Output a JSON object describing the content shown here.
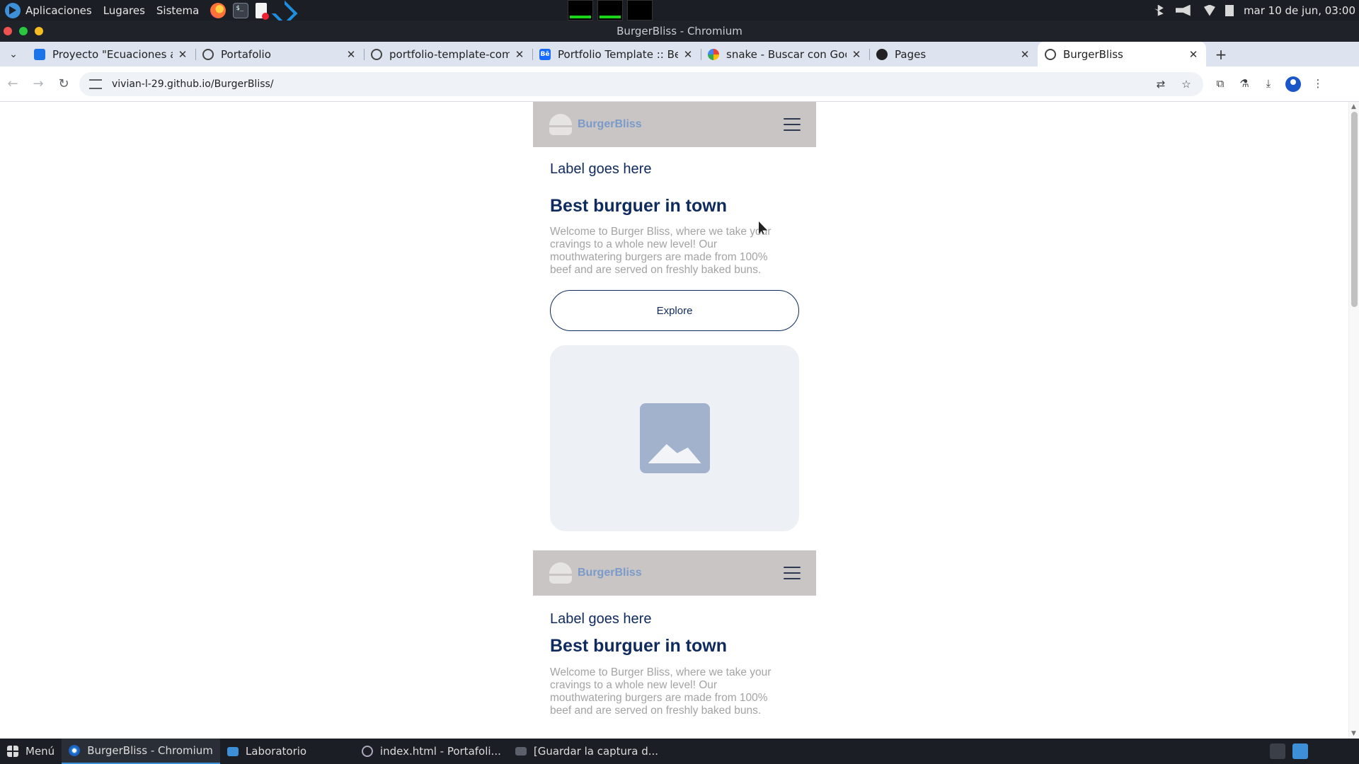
{
  "system_bar": {
    "menus": [
      "Aplicaciones",
      "Lugares",
      "Sistema"
    ],
    "clock": "mar 10 de jun, 03:00"
  },
  "window": {
    "title": "BurgerBliss - Chromium"
  },
  "tabs": [
    {
      "label": "Proyecto \"Ecuaciones aplicadas\"",
      "icon": "classroom-icon"
    },
    {
      "label": "Portafolio",
      "icon": "globe-icon"
    },
    {
      "label": "portfolio-template-community",
      "icon": "globe-icon"
    },
    {
      "label": "Portfolio Template :: Behance",
      "icon": "behance-icon"
    },
    {
      "label": "snake - Buscar con Google",
      "icon": "google-icon"
    },
    {
      "label": "Pages",
      "icon": "github-icon"
    },
    {
      "label": "BurgerBliss",
      "icon": "globe-icon"
    }
  ],
  "toolbar": {
    "url": "vivian-l-29.github.io/BurgerBliss/"
  },
  "page": {
    "brand": "BurgerBliss",
    "sections": [
      {
        "label": "Label goes here",
        "headline": "Best burguer in town",
        "body": "Welcome to Burger Bliss, where we take your cravings to a whole new level! Our mouthwatering burgers are made from 100% beef and are served on freshly baked buns.",
        "button": "Explore"
      },
      {
        "label": "Label goes here",
        "headline": "Best burguer in town",
        "body": "Welcome to Burger Bliss, where we take your cravings to a whole new level! Our mouthwatering burgers are made from 100% beef and are served on freshly baked buns."
      }
    ]
  },
  "taskbar": {
    "menu": "Menú",
    "tasks": [
      "BurgerBliss - Chromium",
      "Laboratorio",
      "index.html - Portafoli...",
      "[Guardar la captura d..."
    ]
  },
  "colors": {
    "brand_navy": "#0f2a5c",
    "header_gray": "#c8c5c4",
    "logo_blue": "#7c9ac9",
    "card_bg": "#edf0f5"
  }
}
